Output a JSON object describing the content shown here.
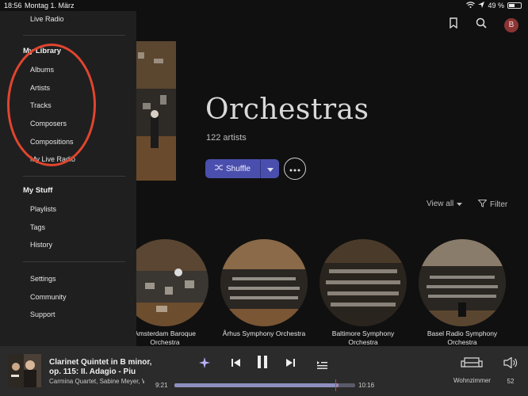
{
  "status_bar": {
    "time": "18:56",
    "date": "Montag 1. März",
    "battery": "49 %",
    "battery_fraction": 0.49
  },
  "header": {
    "avatar_initial": "B"
  },
  "hero": {
    "title": "Orchestras",
    "count": "122 artists",
    "shuffle_label": "Shuffle"
  },
  "toolbar": {
    "view_all": "View all",
    "filter": "Filter"
  },
  "artists": [
    {
      "name": "Amsterdam Baroque Orchestra"
    },
    {
      "name": "Århus Symphony Orchestra"
    },
    {
      "name": "Baltimore Symphony Orchestra"
    },
    {
      "name": "Basel Radio Symphony Orchestra"
    }
  ],
  "sidebar": {
    "live_radio": "Live Radio",
    "library_heading": "My Library",
    "library_items": [
      "Albums",
      "Artists",
      "Tracks",
      "Composers",
      "Compositions",
      "My Live Radio"
    ],
    "stuff_heading": "My Stuff",
    "stuff_items": [
      "Playlists",
      "Tags",
      "History"
    ],
    "footer_items": [
      "Settings",
      "Community",
      "Support"
    ]
  },
  "player": {
    "title_line1": "Clarinet Quintet in B minor,",
    "title_line2": "op. 115: II. Adagio - Piu",
    "artists": "Carmina Quartet, Sabine Meyer, Wolfg",
    "elapsed": "9:21",
    "duration": "10:16",
    "progress_fraction": 0.91,
    "zone": "Wohnzimmer",
    "volume": "52"
  },
  "colors": {
    "accent": "#4a4fae",
    "annotation": "#e0452e",
    "avatar": "#8a3434"
  }
}
